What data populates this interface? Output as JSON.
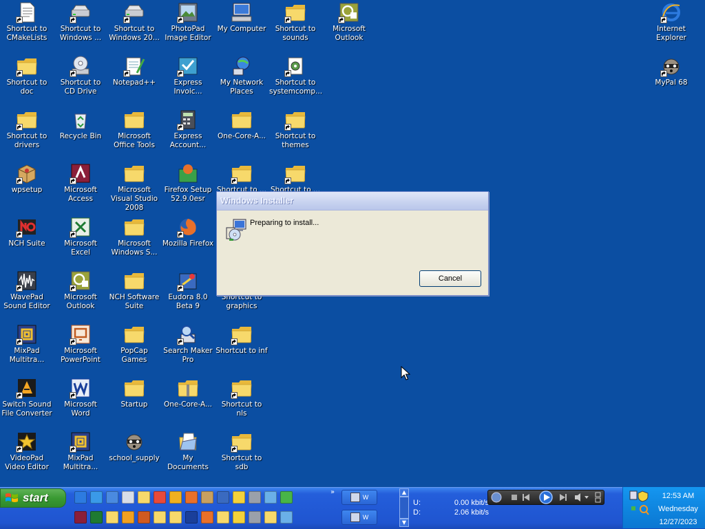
{
  "desktop": {
    "icons": [
      {
        "label": "Shortcut to CMakeLists",
        "kind": "document",
        "shortcut": true
      },
      {
        "label": "Shortcut to Windows ...",
        "kind": "drive",
        "shortcut": true
      },
      {
        "label": "Shortcut to Windows 20...",
        "kind": "drive",
        "shortcut": true
      },
      {
        "label": "PhotoPad Image Editor",
        "kind": "photopad",
        "shortcut": true
      },
      {
        "label": "My Computer",
        "kind": "computer",
        "shortcut": false
      },
      {
        "label": "Shortcut to sounds",
        "kind": "folder",
        "shortcut": true
      },
      {
        "label": "Microsoft Outlook",
        "kind": "outlook",
        "shortcut": true
      },
      {
        "label": "Internet Explorer",
        "kind": "ie",
        "shortcut": true
      },
      {
        "label": "Shortcut to doc",
        "kind": "folder",
        "shortcut": true
      },
      {
        "label": "Shortcut to CD Drive",
        "kind": "cd",
        "shortcut": true
      },
      {
        "label": "Notepad++",
        "kind": "notepad",
        "shortcut": true
      },
      {
        "label": "Express Invoic...",
        "kind": "express",
        "shortcut": true
      },
      {
        "label": "My Network Places",
        "kind": "network",
        "shortcut": false
      },
      {
        "label": "Shortcut to systemcomp...",
        "kind": "gear",
        "shortcut": true
      },
      {
        "label": "MyPal 68",
        "kind": "raccoon",
        "shortcut": true
      },
      {
        "label": "Shortcut to drivers",
        "kind": "folder",
        "shortcut": true
      },
      {
        "label": "Recycle Bin",
        "kind": "recycle",
        "shortcut": false
      },
      {
        "label": "Microsoft Office Tools",
        "kind": "folder",
        "shortcut": false
      },
      {
        "label": "Express Account...",
        "kind": "calculator",
        "shortcut": true
      },
      {
        "label": "One-Core-A...",
        "kind": "folder",
        "shortcut": false
      },
      {
        "label": "Shortcut to themes",
        "kind": "folder",
        "shortcut": true
      },
      {
        "label": "wpsetup",
        "kind": "package",
        "shortcut": true
      },
      {
        "label": "Microsoft Access",
        "kind": "access",
        "shortcut": true
      },
      {
        "label": "Microsoft Visual Studio 2008",
        "kind": "folder",
        "shortcut": false
      },
      {
        "label": "Firefox Setup 52.9.0esr",
        "kind": "firefox-setup",
        "shortcut": false
      },
      {
        "label": "Shortcut to ...",
        "kind": "folder",
        "shortcut": true
      },
      {
        "label": "Shortcut to ...",
        "kind": "folder",
        "shortcut": true
      },
      {
        "label": "NCH Suite",
        "kind": "nch",
        "shortcut": true
      },
      {
        "label": "Microsoft Excel",
        "kind": "excel",
        "shortcut": true
      },
      {
        "label": "Microsoft Windows S...",
        "kind": "folder",
        "shortcut": false
      },
      {
        "label": "Mozilla Firefox",
        "kind": "firefox",
        "shortcut": true
      },
      {
        "label": "WavePad Sound Editor",
        "kind": "wavepad",
        "shortcut": true
      },
      {
        "label": "Microsoft Outlook",
        "kind": "outlook",
        "shortcut": true
      },
      {
        "label": "NCH Software Suite",
        "kind": "folder",
        "shortcut": false
      },
      {
        "label": "Eudora 8.0 Beta 9",
        "kind": "eudora",
        "shortcut": true
      },
      {
        "label": "Shortcut to graphics",
        "kind": "folder",
        "shortcut": true
      },
      {
        "label": "MixPad Multitra...",
        "kind": "mixpad",
        "shortcut": true
      },
      {
        "label": "Microsoft PowerPoint",
        "kind": "powerpoint",
        "shortcut": true
      },
      {
        "label": "PopCap Games",
        "kind": "folder",
        "shortcut": false
      },
      {
        "label": "Search Maker Pro",
        "kind": "search",
        "shortcut": true
      },
      {
        "label": "Shortcut to inf",
        "kind": "folder",
        "shortcut": true
      },
      {
        "label": "Switch Sound File Converter",
        "kind": "switch",
        "shortcut": true
      },
      {
        "label": "Microsoft Word",
        "kind": "word",
        "shortcut": true
      },
      {
        "label": "Startup",
        "kind": "folder",
        "shortcut": false
      },
      {
        "label": "One-Core-A...",
        "kind": "zipfolder",
        "shortcut": false
      },
      {
        "label": "Shortcut to nls",
        "kind": "folder",
        "shortcut": true
      },
      {
        "label": "VideoPad Video Editor",
        "kind": "videopad",
        "shortcut": true
      },
      {
        "label": "MixPad Multitra...",
        "kind": "mixpad",
        "shortcut": true
      },
      {
        "label": "school_supply",
        "kind": "raccoon",
        "shortcut": false
      },
      {
        "label": "My Documents",
        "kind": "mydocs",
        "shortcut": false
      },
      {
        "label": "Shortcut to sdb",
        "kind": "folder",
        "shortcut": true
      }
    ]
  },
  "dialog": {
    "title": "Windows Installer",
    "message": "Preparing to install...",
    "cancel_label": "Cancel",
    "icon": "installer-icon"
  },
  "taskbar": {
    "start_label": "start",
    "quick_launch_icons": [
      "ie-icon",
      "outlook-express-icon",
      "network-icon",
      "desktop-icon",
      "folder-icon",
      "chrome-icon",
      "windows-icon",
      "firefox-icon",
      "tool-icon",
      "media-icon",
      "notepad-icon",
      "calculator-icon",
      "paint-icon",
      "photo-icon",
      "access-icon",
      "excel-icon",
      "folder-icon",
      "outlook-icon",
      "powerpoint-icon",
      "folder-icon",
      "folder-icon",
      "word-icon",
      "firefox-icon",
      "folder-icon",
      "notepad-icon",
      "calculator-icon",
      "folder-icon",
      "paint-icon"
    ],
    "more_chevron": "»",
    "task_buttons": [
      {
        "label": "W"
      },
      {
        "label": "W"
      }
    ],
    "net_meter": {
      "up_label": "U:",
      "up_value": "0.00 kbit/s",
      "down_label": "D:",
      "down_value": "2.06 kbit/s"
    },
    "clock": {
      "time": "12:53 AM",
      "day": "Wednesday",
      "date": "12/27/2023"
    }
  },
  "colors": {
    "desktop_bg": "#0b4ea2",
    "folder": "#f5d76e",
    "taskbar": "#245edb",
    "start": "#3a9a33",
    "tray": "#0f86e0"
  }
}
